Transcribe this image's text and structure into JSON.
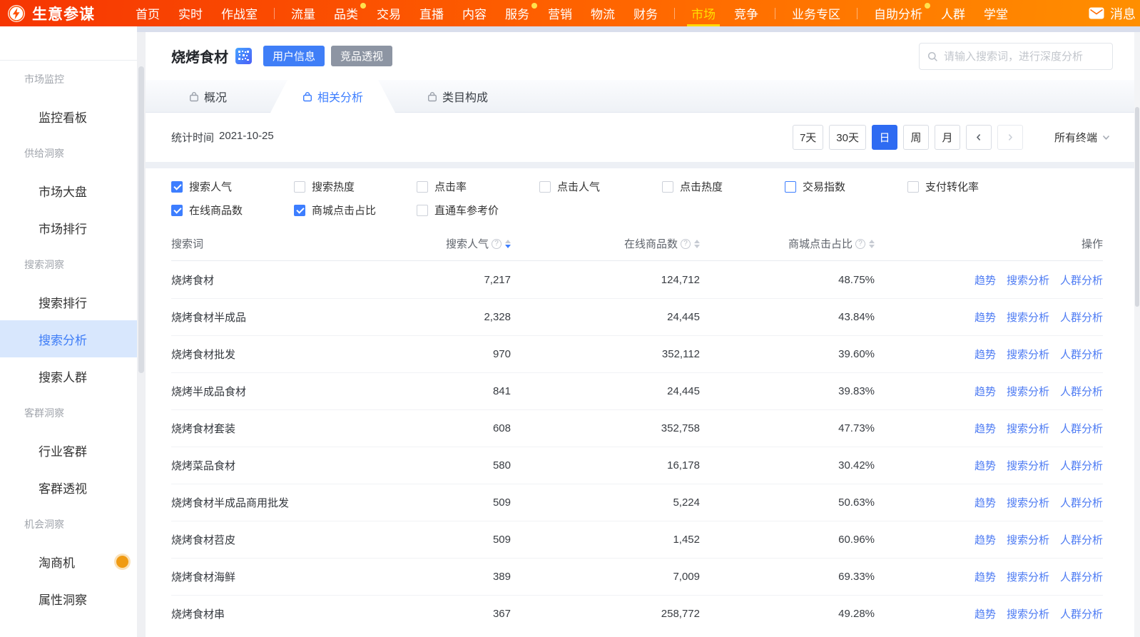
{
  "brand": {
    "name": "生意参谋"
  },
  "nav": {
    "items": [
      {
        "label": "首页"
      },
      {
        "label": "实时"
      },
      {
        "label": "作战室",
        "divider_after": true
      },
      {
        "label": "流量"
      },
      {
        "label": "品类",
        "badge": true
      },
      {
        "label": "交易"
      },
      {
        "label": "直播"
      },
      {
        "label": "内容"
      },
      {
        "label": "服务",
        "badge": true
      },
      {
        "label": "营销"
      },
      {
        "label": "物流"
      },
      {
        "label": "财务",
        "divider_after": true
      },
      {
        "label": "市场",
        "active": true
      },
      {
        "label": "竞争",
        "divider_after": true
      },
      {
        "label": "业务专区",
        "divider_after": true
      },
      {
        "label": "自助分析",
        "badge": true
      },
      {
        "label": "人群"
      },
      {
        "label": "学堂"
      }
    ],
    "message_label": "消息"
  },
  "sidebar": {
    "groups": [
      {
        "label": "市场监控",
        "items": [
          {
            "label": "监控看板"
          }
        ]
      },
      {
        "label": "供给洞察",
        "items": [
          {
            "label": "市场大盘"
          },
          {
            "label": "市场排行"
          }
        ]
      },
      {
        "label": "搜索洞察",
        "items": [
          {
            "label": "搜索排行"
          },
          {
            "label": "搜索分析",
            "active": true
          },
          {
            "label": "搜索人群"
          }
        ]
      },
      {
        "label": "客群洞察",
        "items": [
          {
            "label": "行业客群"
          },
          {
            "label": "客群透视"
          }
        ]
      },
      {
        "label": "机会洞察",
        "items": [
          {
            "label": "淘商机",
            "badge": true
          },
          {
            "label": "属性洞察"
          }
        ]
      }
    ]
  },
  "header": {
    "title": "烧烤食材",
    "user_info_button": "用户信息",
    "competitor_button": "竞品透视",
    "search_placeholder": "请输入搜索词，进行深度分析"
  },
  "tabs": [
    {
      "label": "概况"
    },
    {
      "label": "相关分析",
      "active": true
    },
    {
      "label": "类目构成"
    }
  ],
  "toolbar": {
    "stat_time_label": "统计时间",
    "stat_date": "2021-10-25",
    "ranges": [
      {
        "label": "7天"
      },
      {
        "label": "30天"
      },
      {
        "label": "日",
        "active": true
      },
      {
        "label": "周"
      },
      {
        "label": "月"
      }
    ],
    "terminal_label": "所有终端"
  },
  "filters": {
    "rows": [
      [
        {
          "label": "搜索人气",
          "checked": true
        },
        {
          "label": "搜索热度",
          "checked": false
        },
        {
          "label": "点击率",
          "checked": false
        },
        {
          "label": "点击人气",
          "checked": false
        },
        {
          "label": "点击热度",
          "checked": false
        },
        {
          "label": "交易指数",
          "checked": false,
          "focus": true
        },
        {
          "label": "支付转化率",
          "checked": false
        }
      ],
      [
        {
          "label": "在线商品数",
          "checked": true
        },
        {
          "label": "商城点击占比",
          "checked": true
        },
        {
          "label": "直通车参考价",
          "checked": false
        }
      ]
    ]
  },
  "table": {
    "columns": [
      {
        "label": "搜索词"
      },
      {
        "label": "搜索人气",
        "help": true,
        "sort": "desc"
      },
      {
        "label": "在线商品数",
        "help": true,
        "sort": "none"
      },
      {
        "label": "商城点击占比",
        "help": true,
        "sort": "none"
      },
      {
        "label": "操作"
      }
    ],
    "action_labels": [
      "趋势",
      "搜索分析",
      "人群分析"
    ],
    "rows": [
      {
        "keyword": "烧烤食材",
        "search_popularity": "7,217",
        "online_products": "124,712",
        "mall_click_rate": "48.75%"
      },
      {
        "keyword": "烧烤食材半成品",
        "search_popularity": "2,328",
        "online_products": "24,445",
        "mall_click_rate": "43.84%"
      },
      {
        "keyword": "烧烤食材批发",
        "search_popularity": "970",
        "online_products": "352,112",
        "mall_click_rate": "39.60%"
      },
      {
        "keyword": "烧烤半成品食材",
        "search_popularity": "841",
        "online_products": "24,445",
        "mall_click_rate": "39.83%"
      },
      {
        "keyword": "烧烤食材套装",
        "search_popularity": "608",
        "online_products": "352,758",
        "mall_click_rate": "47.73%"
      },
      {
        "keyword": "烧烤菜品食材",
        "search_popularity": "580",
        "online_products": "16,178",
        "mall_click_rate": "30.42%"
      },
      {
        "keyword": "烧烤食材半成品商用批发",
        "search_popularity": "509",
        "online_products": "5,224",
        "mall_click_rate": "50.63%"
      },
      {
        "keyword": "烧烤食材苕皮",
        "search_popularity": "509",
        "online_products": "1,452",
        "mall_click_rate": "60.96%"
      },
      {
        "keyword": "烧烤食材海鲜",
        "search_popularity": "389",
        "online_products": "7,009",
        "mall_click_rate": "69.33%"
      },
      {
        "keyword": "烧烤食材串",
        "search_popularity": "367",
        "online_products": "258,772",
        "mall_click_rate": "49.28%"
      }
    ]
  },
  "colors": {
    "accent": "#3d7eff",
    "nav_gradient_start": "#f63502",
    "nav_gradient_end": "#ff8f00",
    "nav_active_yellow": "#ffd900",
    "badge_orange": "#f09b13"
  }
}
